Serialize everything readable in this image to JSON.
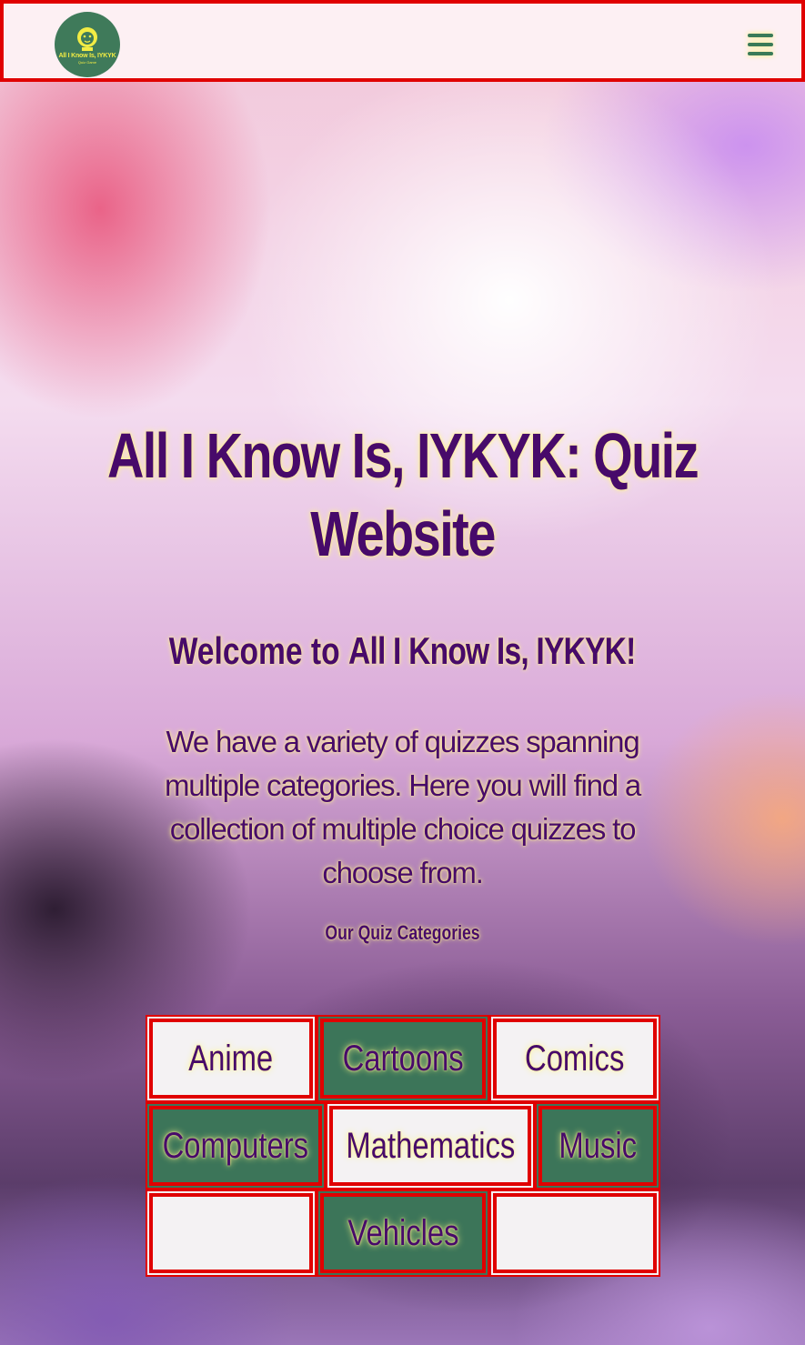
{
  "header": {
    "logo": {
      "text": "All I Know Is, IYKYK",
      "subtext": "Quiz Game",
      "icon": "lion-head-icon"
    },
    "menu_icon": "hamburger-menu-icon"
  },
  "hero": {
    "title": "All I Know Is, IYKYK: Quiz Website",
    "welcome_prefix": "Welcome to ",
    "welcome_name": "All I Know Is, IYKYK",
    "welcome_suffix": "!",
    "intro": "We have a variety of quizzes spanning multiple categories. Here you will find a collection of multiple choice quizzes to choose from."
  },
  "categories": {
    "heading": "Our Quiz Categories",
    "items": [
      {
        "label": "Anime",
        "style": "light"
      },
      {
        "label": "Cartoons",
        "style": "green"
      },
      {
        "label": "Comics",
        "style": "light"
      },
      {
        "label": "Computers",
        "style": "green"
      },
      {
        "label": "Mathematics",
        "style": "light"
      },
      {
        "label": "Music",
        "style": "green"
      },
      {
        "label": "",
        "style": "light"
      },
      {
        "label": "Vehicles",
        "style": "green"
      },
      {
        "label": "",
        "style": "light"
      }
    ]
  },
  "colors": {
    "primary_text": "#470a6a",
    "glow": "#fff48a",
    "border": "#e00000",
    "green": "#3c7559",
    "header_bg": "#fdf0f3"
  }
}
